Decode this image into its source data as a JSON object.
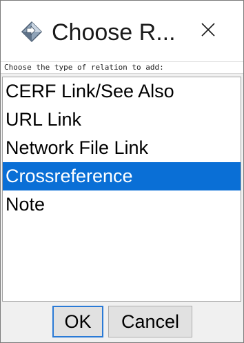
{
  "window": {
    "title": "Choose R..."
  },
  "prompt": "Choose the type of relation to add:",
  "list": {
    "items": [
      {
        "label": "CERF Link/See Also",
        "selected": false
      },
      {
        "label": "URL Link",
        "selected": false
      },
      {
        "label": "Network File Link",
        "selected": false
      },
      {
        "label": "Crossreference",
        "selected": true
      },
      {
        "label": "Note",
        "selected": false
      }
    ]
  },
  "buttons": {
    "ok_label": "OK",
    "cancel_label": "Cancel"
  },
  "icons": {
    "app": "app-diamond-icon",
    "close": "close-icon"
  },
  "colors": {
    "selection": "#0a6fd6",
    "default_button_border": "#2a7ad6"
  }
}
